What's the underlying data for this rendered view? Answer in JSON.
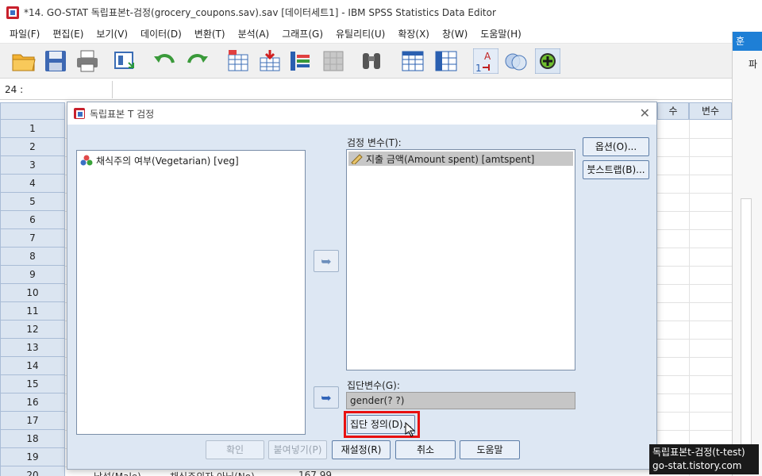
{
  "window": {
    "title": "*14. GO-STAT 독립표본t-검정(grocery_coupons.sav).sav [데이터세트1] - IBM SPSS Statistics Data Editor"
  },
  "menu": [
    "파일(F)",
    "편집(E)",
    "보기(V)",
    "데이터(D)",
    "변환(T)",
    "분석(A)",
    "그래프(G)",
    "유틸리티(U)",
    "확장(X)",
    "창(W)",
    "도움말(H)"
  ],
  "cellbar": {
    "ref": "24 :"
  },
  "grid": {
    "rows": [
      "1",
      "2",
      "3",
      "4",
      "5",
      "6",
      "7",
      "8",
      "9",
      "10",
      "11",
      "12",
      "13",
      "14",
      "15",
      "16",
      "17",
      "18",
      "19"
    ],
    "colheads": [
      "수",
      "변수"
    ],
    "bottom_row": {
      "num": "20",
      "gender": "남성(Male)",
      "veg": "채식주의자 아님(No)",
      "amt": "167.99"
    }
  },
  "right_panel": {
    "tab": "훈",
    "label": "파"
  },
  "dialog": {
    "title": "독립표본 T 검정",
    "source_list": [
      "채식주의 여부(Vegetarian) [veg]"
    ],
    "test_label": "검정 변수(T):",
    "test_list": [
      "지출 금액(Amount spent) [amtspent]"
    ],
    "group_label": "집단변수(G):",
    "group_value": "gender(? ?)",
    "define_groups": "집단 정의(D)...",
    "options": "옵션(O)...",
    "bootstrap": "붓스트랩(B)...",
    "ok": "확인",
    "paste": "붙여넣기(P)",
    "reset": "재설정(R)",
    "cancel": "취소",
    "help": "도움말"
  },
  "watermark": {
    "line1": "독립표본t-검정(t-test)",
    "line2": "go-stat.tistory.com"
  }
}
